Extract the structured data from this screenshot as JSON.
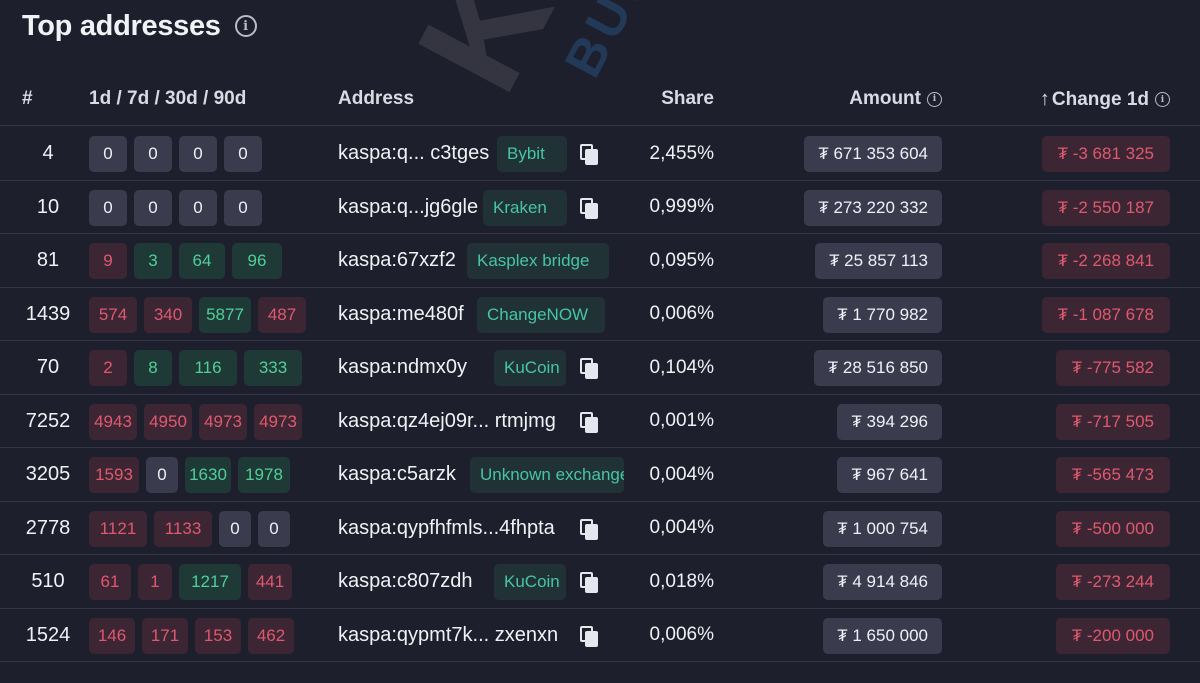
{
  "page": {
    "title": "Top addresses"
  },
  "table": {
    "headers": {
      "rank": "#",
      "deltas": "1d / 7d / 30d / 90d",
      "address": "Address",
      "share": "Share",
      "amount": "Amount",
      "change": "Change 1d"
    },
    "rows": [
      {
        "rank": "4",
        "deltas": [
          [
            "0",
            "neutral"
          ],
          [
            "0",
            "neutral"
          ],
          [
            "0",
            "neutral"
          ],
          [
            "0",
            "neutral"
          ]
        ],
        "address": "kaspa:q... c3tges",
        "tag": "Bybit",
        "share": "2,455%",
        "amount": "₮ 671 353 604",
        "change": "₮ -3 681 325"
      },
      {
        "rank": "10",
        "deltas": [
          [
            "0",
            "neutral"
          ],
          [
            "0",
            "neutral"
          ],
          [
            "0",
            "neutral"
          ],
          [
            "0",
            "neutral"
          ]
        ],
        "address": "kaspa:q...jg6gle",
        "tag": "Kraken",
        "share": "0,999%",
        "amount": "₮ 273 220 332",
        "change": "₮ -2 550 187"
      },
      {
        "rank": "81",
        "deltas": [
          [
            "9",
            "neg"
          ],
          [
            "3",
            "pos"
          ],
          [
            "64",
            "pos"
          ],
          [
            "96",
            "pos"
          ]
        ],
        "address": "kaspa:67xzf2",
        "tag": "Kasplex bridge",
        "share": "0,095%",
        "amount": "₮ 25 857 113",
        "change": "₮ -2 268 841"
      },
      {
        "rank": "1439",
        "deltas": [
          [
            "574",
            "neg"
          ],
          [
            "340",
            "neg"
          ],
          [
            "5877",
            "pos"
          ],
          [
            "487",
            "neg"
          ]
        ],
        "address": "kaspa:me480f",
        "tag": "ChangeNOW",
        "share": "0,006%",
        "amount": "₮ 1 770 982",
        "change": "₮ -1 087 678"
      },
      {
        "rank": "70",
        "deltas": [
          [
            "2",
            "neg"
          ],
          [
            "8",
            "pos"
          ],
          [
            "116",
            "pos"
          ],
          [
            "333",
            "pos"
          ]
        ],
        "address": "kaspa:ndmx0y",
        "tag": "KuCoin",
        "share": "0,104%",
        "amount": "₮ 28 516 850",
        "change": "₮ -775 582"
      },
      {
        "rank": "7252",
        "deltas": [
          [
            "4943",
            "neg"
          ],
          [
            "4950",
            "neg"
          ],
          [
            "4973",
            "neg"
          ],
          [
            "4973",
            "neg"
          ]
        ],
        "address": "kaspa:qz4ej09r... rtmjmg",
        "tag": "",
        "share": "0,001%",
        "amount": "₮ 394 296",
        "change": "₮ -717 505"
      },
      {
        "rank": "3205",
        "deltas": [
          [
            "1593",
            "neg"
          ],
          [
            "0",
            "neutral"
          ],
          [
            "1630",
            "pos"
          ],
          [
            "1978",
            "pos"
          ]
        ],
        "address": "kaspa:c5arzk",
        "tag": "Unknown exchange",
        "share": "0,004%",
        "amount": "₮ 967 641",
        "change": "₮ -565 473"
      },
      {
        "rank": "2778",
        "deltas": [
          [
            "1121",
            "neg"
          ],
          [
            "1133",
            "neg"
          ],
          [
            "0",
            "neutral"
          ],
          [
            "0",
            "neutral"
          ]
        ],
        "address": "kaspa:qypfhfmls...4fhpta",
        "tag": "",
        "share": "0,004%",
        "amount": "₮ 1 000 754",
        "change": "₮ -500 000"
      },
      {
        "rank": "510",
        "deltas": [
          [
            "61",
            "neg"
          ],
          [
            "1",
            "neg"
          ],
          [
            "1217",
            "pos"
          ],
          [
            "441",
            "neg"
          ]
        ],
        "address": "kaspa:c807zdh",
        "tag": "KuCoin",
        "share": "0,018%",
        "amount": "₮ 4 914 846",
        "change": "₮ -273 244"
      },
      {
        "rank": "1524",
        "deltas": [
          [
            "146",
            "neg"
          ],
          [
            "171",
            "neg"
          ],
          [
            "153",
            "neg"
          ],
          [
            "462",
            "neg"
          ]
        ],
        "address": "kaspa:qypmt7k... zxenxn",
        "tag": "",
        "share": "0,006%",
        "amount": "₮ 1 650 000",
        "change": "₮ -200 000"
      }
    ]
  },
  "watermark": {
    "brand": "Kaspa",
    "sub": "BUILDERS"
  }
}
